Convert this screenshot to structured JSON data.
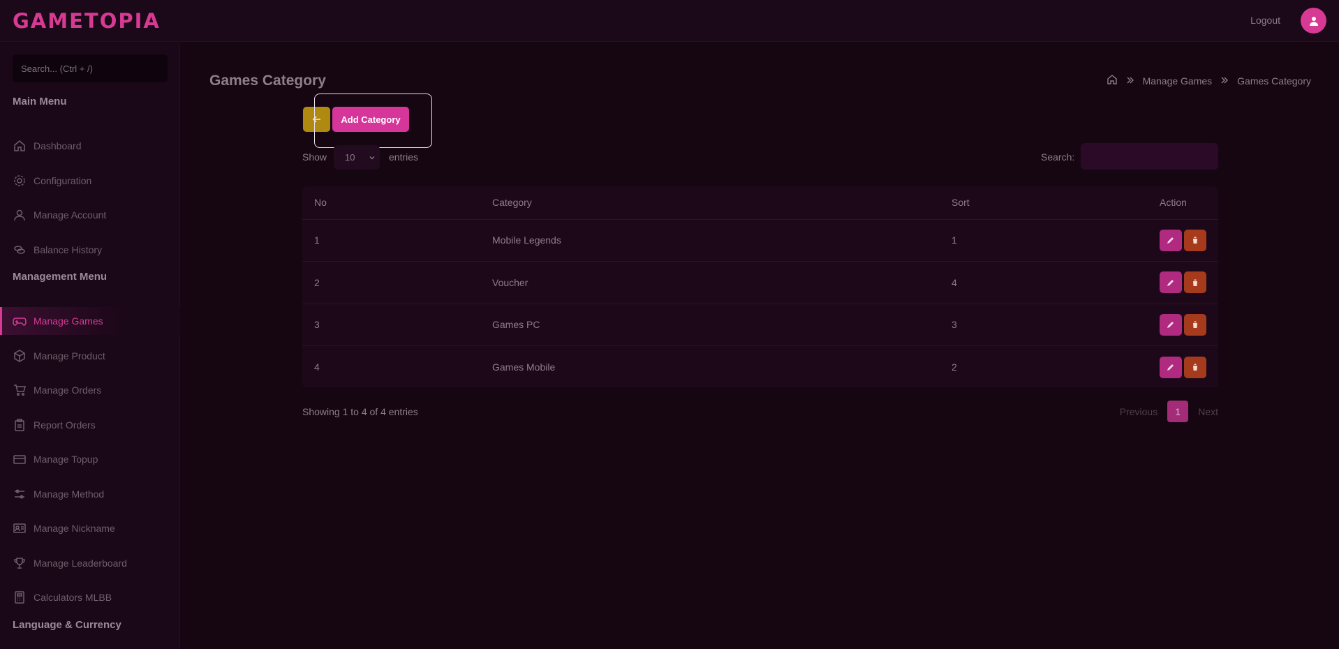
{
  "brand": {
    "logo": "GAMETOPIA",
    "accent": "#d63a93"
  },
  "header": {
    "logout": "Logout"
  },
  "sidebar": {
    "search_placeholder": "Search... (Ctrl + /)",
    "main_menu_title": "Main Menu",
    "main_items": [
      {
        "label": "Dashboard",
        "icon": "home-icon"
      },
      {
        "label": "Configuration",
        "icon": "gear-icon"
      },
      {
        "label": "Manage Account",
        "icon": "user-icon"
      },
      {
        "label": "Balance History",
        "icon": "coins-icon"
      }
    ],
    "management_menu_title": "Management Menu",
    "management_items": [
      {
        "label": "Manage Games",
        "icon": "gamepad-icon",
        "active": true
      },
      {
        "label": "Manage Product",
        "icon": "box-icon"
      },
      {
        "label": "Manage Orders",
        "icon": "cart-icon"
      },
      {
        "label": "Report Orders",
        "icon": "clipboard-icon"
      },
      {
        "label": "Manage Topup",
        "icon": "wallet-icon"
      },
      {
        "label": "Manage Method",
        "icon": "sliders-icon"
      },
      {
        "label": "Manage Nickname",
        "icon": "id-card-icon"
      },
      {
        "label": "Manage Leaderboard",
        "icon": "trophy-icon"
      },
      {
        "label": "Calculators MLBB",
        "icon": "calculator-icon"
      }
    ],
    "language_title": "Language & Currency"
  },
  "main": {
    "title": "Games Category",
    "breadcrumb": [
      "Manage Games",
      "Games Category"
    ],
    "add_button": "Add Category",
    "show_label": "Show",
    "page_length": "10",
    "entries_label": "entries",
    "search_label": "Search:",
    "table": {
      "headers": [
        "No",
        "Category",
        "Sort",
        "Action"
      ],
      "rows": [
        {
          "no": "1",
          "category": "Mobile Legends",
          "sort": "1"
        },
        {
          "no": "2",
          "category": "Voucher",
          "sort": "4"
        },
        {
          "no": "3",
          "category": "Games PC",
          "sort": "3"
        },
        {
          "no": "4",
          "category": "Games Mobile",
          "sort": "2"
        }
      ]
    },
    "info": "Showing 1 to 4 of 4 entries",
    "pager": {
      "previous": "Previous",
      "current": "1",
      "next": "Next"
    }
  }
}
